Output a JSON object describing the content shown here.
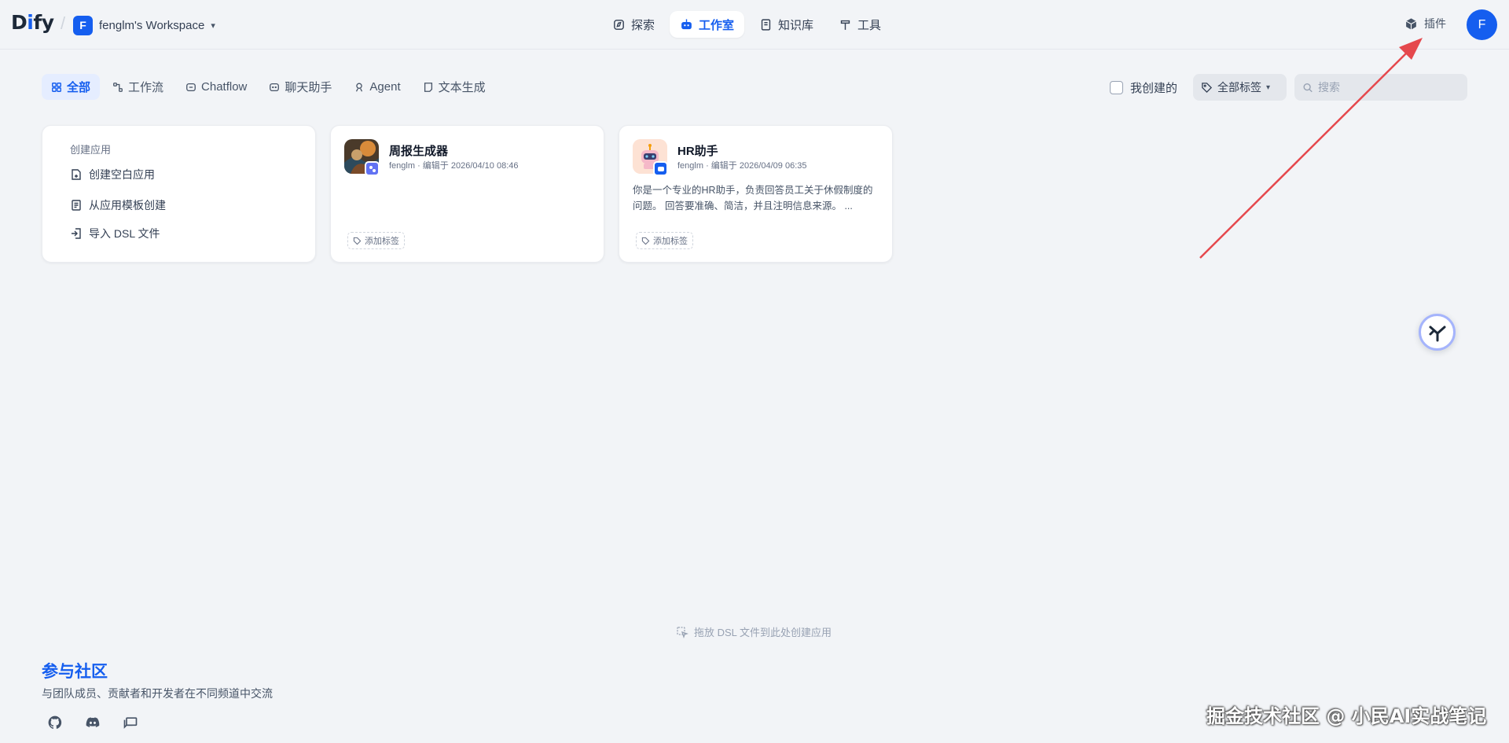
{
  "brand": {
    "logo": "Dify"
  },
  "workspace": {
    "avatar": "F",
    "name": "fenglm's Workspace"
  },
  "nav": [
    {
      "label": "探索",
      "icon": "compass-icon"
    },
    {
      "label": "工作室",
      "icon": "robot-icon",
      "active": true
    },
    {
      "label": "知识库",
      "icon": "book-icon"
    },
    {
      "label": "工具",
      "icon": "hammer-icon"
    }
  ],
  "plugins_label": "插件",
  "user_avatar": "F",
  "filter_tabs": [
    {
      "label": "全部",
      "active": true
    },
    {
      "label": "工作流"
    },
    {
      "label": "Chatflow"
    },
    {
      "label": "聊天助手"
    },
    {
      "label": "Agent"
    },
    {
      "label": "文本生成"
    }
  ],
  "mine_label": "我创建的",
  "tag_select_label": "全部标签",
  "search": {
    "placeholder": "搜索",
    "value": ""
  },
  "create": {
    "title": "创建应用",
    "items": [
      "创建空白应用",
      "从应用模板创建",
      "导入 DSL 文件"
    ]
  },
  "apps": [
    {
      "name": "周报生成器",
      "meta": "fenglm · 编辑于 2026/04/10 08:46",
      "description": "",
      "tag_label": "添加标签"
    },
    {
      "name": "HR助手",
      "meta": "fenglm · 编辑于 2026/04/09 06:35",
      "description": "你是一个专业的HR助手，负责回答员工关于休假制度的问题。 回答要准确、简洁，并且注明信息来源。 ...",
      "tag_label": "添加标签"
    }
  ],
  "dropzone_text": "拖放 DSL 文件到此处创建应用",
  "community": {
    "title": "参与社区",
    "subtitle": "与团队成员、贡献者和开发者在不同频道中交流",
    "links": [
      "github-icon",
      "discord-icon",
      "forum-icon"
    ]
  },
  "watermark": "掘金技术社区 @ 小民AI实战笔记",
  "colors": {
    "accent": "#155eef",
    "background": "#f2f4f7",
    "annotation_arrow": "#e5484d"
  }
}
